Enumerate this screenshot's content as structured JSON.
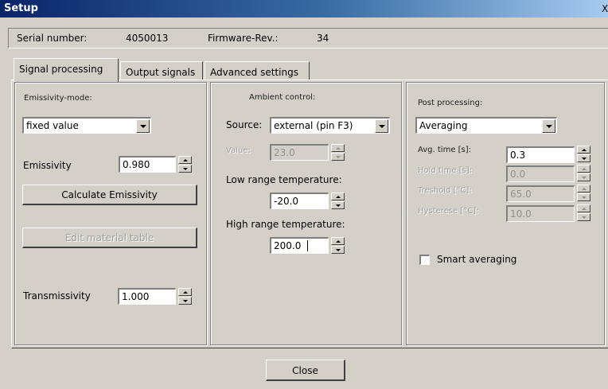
{
  "window": {
    "title": "Setup",
    "close_glyph": "X"
  },
  "info": {
    "serial_label": "Serial number:",
    "serial_value": "4050013",
    "firmware_label": "Firmware-Rev.:",
    "firmware_value": "34"
  },
  "tabs": [
    {
      "label": "Signal processing",
      "active": true
    },
    {
      "label": "Output signals",
      "active": false
    },
    {
      "label": "Advanced settings",
      "active": false
    }
  ],
  "emissivity_group": {
    "title": "Emissivity-mode:",
    "mode_value": "fixed value",
    "emissivity_label": "Emissivity",
    "emissivity_value": "0.980",
    "calculate_button": "Calculate Emissivity",
    "edit_table_button": "Edit material table",
    "transmissivity_label": "Transmissivity",
    "transmissivity_value": "1.000"
  },
  "ambient_group": {
    "title": "Ambient control:",
    "source_label": "Source:",
    "source_value": "external (pin F3)",
    "value_label": "Value:",
    "value_value": "23.0",
    "low_label": "Low range temperature:",
    "low_value": "-20.0",
    "high_label": "High range temperature:",
    "high_value": "200.0"
  },
  "post_group": {
    "title": "Post processing:",
    "mode_value": "Averaging",
    "avg_label": "Avg. time [s]:",
    "avg_value": "0.3",
    "hold_label": "Hold time [s]:",
    "hold_value": "0.0",
    "threshold_label": "Treshold [°C]:",
    "threshold_value": "65.0",
    "hysteresis_label": "Hysterese [°C]:",
    "hysteresis_value": "10.0",
    "smart_label": "Smart averaging",
    "smart_checked": false
  },
  "footer": {
    "close_button": "Close"
  }
}
